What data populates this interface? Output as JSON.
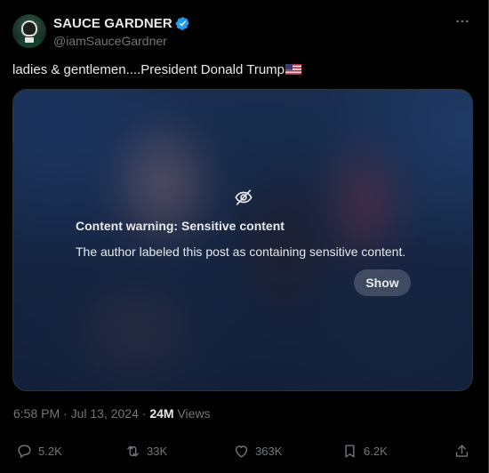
{
  "author": {
    "display_name": "SAUCE GARDNER",
    "handle": "@iamSauceGardner",
    "verified_color": "#1d9bf0"
  },
  "post": {
    "text": "ladies & gentlemen....President Donald Trump",
    "emoji": "flag-us-icon"
  },
  "media": {
    "warning_icon": "eye-slash-icon",
    "warning_title": "Content warning: Sensitive content",
    "warning_description": "The author labeled this post as containing sensitive content.",
    "show_label": "Show"
  },
  "meta": {
    "time": "6:58 PM",
    "separator": "·",
    "date": "Jul 13, 2024",
    "views_count": "24M",
    "views_label": "Views"
  },
  "actions": {
    "replies": "5.2K",
    "reposts": "33K",
    "likes": "363K",
    "bookmarks": "6.2K"
  },
  "colors": {
    "background": "#000000",
    "text": "#e7e9ea",
    "muted": "#71767b",
    "accent": "#1d9bf0"
  }
}
